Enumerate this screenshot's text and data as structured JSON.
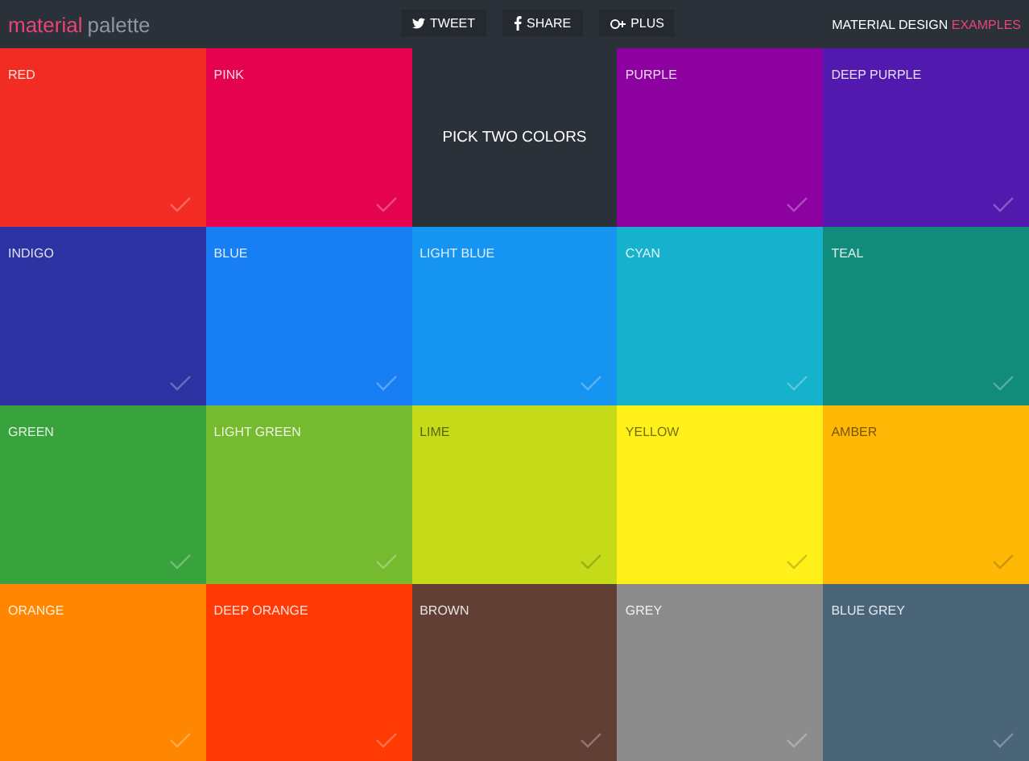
{
  "header": {
    "logo_primary": "material",
    "logo_secondary": "palette",
    "share_buttons": [
      {
        "kind": "twitter",
        "label": "TWEET"
      },
      {
        "kind": "facebook",
        "label": "SHARE"
      },
      {
        "kind": "gplus",
        "label": "PLUS"
      }
    ],
    "nav_link": {
      "label": "MATERIAL DESIGN",
      "accent": "EXAMPLES"
    }
  },
  "swatches": [
    {
      "kind": "color",
      "name": "RED",
      "color": "#f22b23"
    },
    {
      "kind": "color",
      "name": "PINK",
      "color": "#e5024e"
    },
    {
      "kind": "prompt",
      "name": "PICK TWO COLORS"
    },
    {
      "kind": "color",
      "name": "PURPLE",
      "color": "#8c01a0"
    },
    {
      "kind": "color",
      "name": "DEEP PURPLE",
      "color": "#5219ae"
    },
    {
      "kind": "color",
      "name": "INDIGO",
      "color": "#2e33a3"
    },
    {
      "kind": "color",
      "name": "BLUE",
      "color": "#177ff3"
    },
    {
      "kind": "color",
      "name": "LIGHT BLUE",
      "color": "#1595f1"
    },
    {
      "kind": "color",
      "name": "CYAN",
      "color": "#16b2cd"
    },
    {
      "kind": "color",
      "name": "TEAL",
      "color": "#118c7b"
    },
    {
      "kind": "color",
      "name": "GREEN",
      "color": "#38a33c"
    },
    {
      "kind": "color",
      "name": "LIGHT GREEN",
      "color": "#76ba30"
    },
    {
      "kind": "color",
      "name": "LIME",
      "color": "#c5da19"
    },
    {
      "kind": "color",
      "name": "YELLOW",
      "color": "#fff01a"
    },
    {
      "kind": "color",
      "name": "AMBER",
      "color": "#ffb806"
    },
    {
      "kind": "color",
      "name": "ORANGE",
      "color": "#ff8600"
    },
    {
      "kind": "color",
      "name": "DEEP ORANGE",
      "color": "#ff3a05"
    },
    {
      "kind": "color",
      "name": "BROWN",
      "color": "#613f34"
    },
    {
      "kind": "color",
      "name": "GREY",
      "color": "#8c8c8c"
    },
    {
      "kind": "color",
      "name": "BLUE GREY",
      "color": "#4a6577"
    }
  ]
}
